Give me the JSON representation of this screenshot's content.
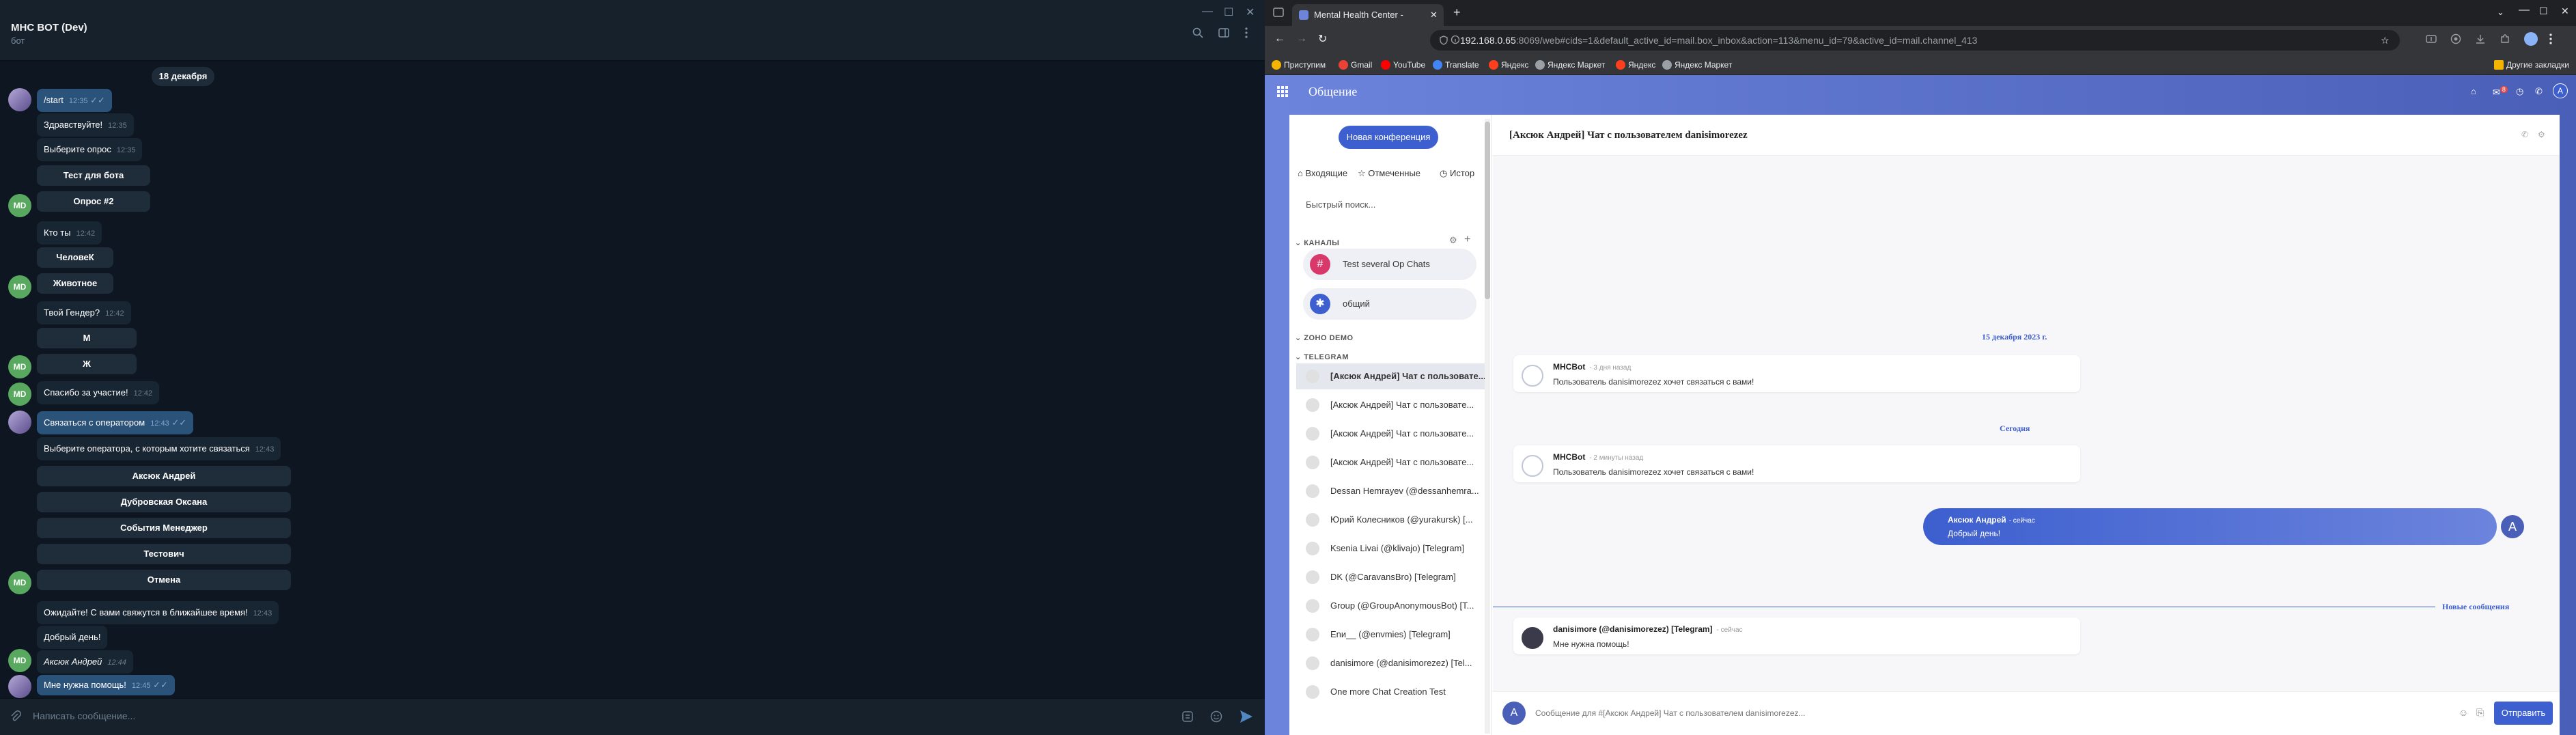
{
  "telegram": {
    "chat_title": "MHC BOT (Dev)",
    "chat_subtitle": "бот",
    "date_sep": "18 декабря",
    "input_placeholder": "Написать сообщение...",
    "avatar_bot": "MD",
    "messages": [
      {
        "text": "/start",
        "time": "12:35"
      },
      {
        "text": "Здравствуйте!",
        "time": "12:35"
      },
      {
        "text": "Выберите опрос",
        "time": "12:35"
      },
      {
        "text": "Кто ты",
        "time": "12:42"
      },
      {
        "text": "Твой Гендер?",
        "time": "12:42"
      },
      {
        "text": "Спасибо за участие!",
        "time": "12:42"
      },
      {
        "text": "Связаться с оператором",
        "time": "12:43"
      },
      {
        "text": "Выберите оператора, с которым хотите связаться",
        "time": "12:43"
      },
      {
        "text": "Ожидайте! С вами свяжутся в ближайшее время!",
        "time": "12:43"
      },
      {
        "text": "Добрый день!",
        "time": ""
      },
      {
        "text": "Аксюк Андрей",
        "time": "12:44"
      },
      {
        "text": "Мне нужна помощь!",
        "time": "12:45"
      }
    ],
    "kb_survey": [
      "Тест для бота",
      "Опрос #2"
    ],
    "kb_who": [
      "ЧеловеК",
      "Животное"
    ],
    "kb_gender": [
      "М",
      "Ж"
    ],
    "kb_operators": [
      "Аксюк Андрей",
      "Дубровская Оксана",
      "События Менеджер",
      "Тестович",
      "Отмена"
    ]
  },
  "browser": {
    "tab_title": "Mental Health Center - Общение",
    "url_host": "192.168.0.65",
    "url_rest": ":8069/web#cids=1&default_active_id=mail.box_inbox&action=113&menu_id=79&active_id=mail.channel_413",
    "bookmarks": [
      "Приступим",
      "Gmail",
      "YouTube",
      "Translate",
      "Яндекс",
      "Яндекс Маркет",
      "Яндекс",
      "Яндекс Маркет"
    ],
    "other_bookmarks": "Другие закладки",
    "notification_count": "8"
  },
  "odoo": {
    "app_title": "Общение",
    "new_conf": "Новая конференция",
    "filters": [
      "Входящие",
      "Отмеченные",
      "Истор"
    ],
    "quick_search": "Быстрый поиск...",
    "section_channels": "КАНАЛЫ",
    "channels": [
      {
        "name": "Test several Op Chats",
        "icon": "#"
      },
      {
        "name": "общий",
        "icon": "✱"
      }
    ],
    "section_zoho": "ZOHO DEMO",
    "section_telegram": "TELEGRAM",
    "chats": [
      "[Аксюк Андрей] Чат с пользовате...",
      "[Аксюк Андрей] Чат с пользовате...",
      "[Аксюк Андрей] Чат с пользовате...",
      "[Аксюк Андрей] Чат с пользовате...",
      "Dessan Hemrayev (@dessanhemra...",
      "Юрий Колесников (@yurakursk) [...",
      "Ksenia Livai (@klivajo) [Telegram]",
      "DK (@CaravansBro) [Telegram]",
      "Group (@GroupAnonymousBot) [T...",
      "Enи__ (@envmies) [Telegram]",
      "danisimore (@danisimorezez) [Tel...",
      "One more Chat Creation Test"
    ],
    "chat_title": "[Аксюк Андрей] Чат с пользователем danisimorezez",
    "date1": "15 декабря 2023 г.",
    "date2": "Сегодня",
    "msg1": {
      "author": "MHCBot",
      "time": "- 3 дня назад",
      "text": "Пользователь danisimorezez хочет связаться с вами!"
    },
    "msg2": {
      "author": "MHCBot",
      "time": "- 2 минуты назад",
      "text": "Пользователь danisimorezez хочет связаться с вами!"
    },
    "msg3": {
      "author": "Аксюк Андрей",
      "time": "- сейчас",
      "text": "Добрый день!"
    },
    "msg4": {
      "author": "danisimore (@danisimorezez) [Telegram]",
      "time": "- сейчас",
      "text": "Мне нужна помощь!"
    },
    "new_messages": "Новые сообщения",
    "my_avatar": "A",
    "composer_placeholder": "Сообщение для #[Аксюк Андрей] Чат с пользователем danisimorezez...",
    "send": "Отправить"
  }
}
